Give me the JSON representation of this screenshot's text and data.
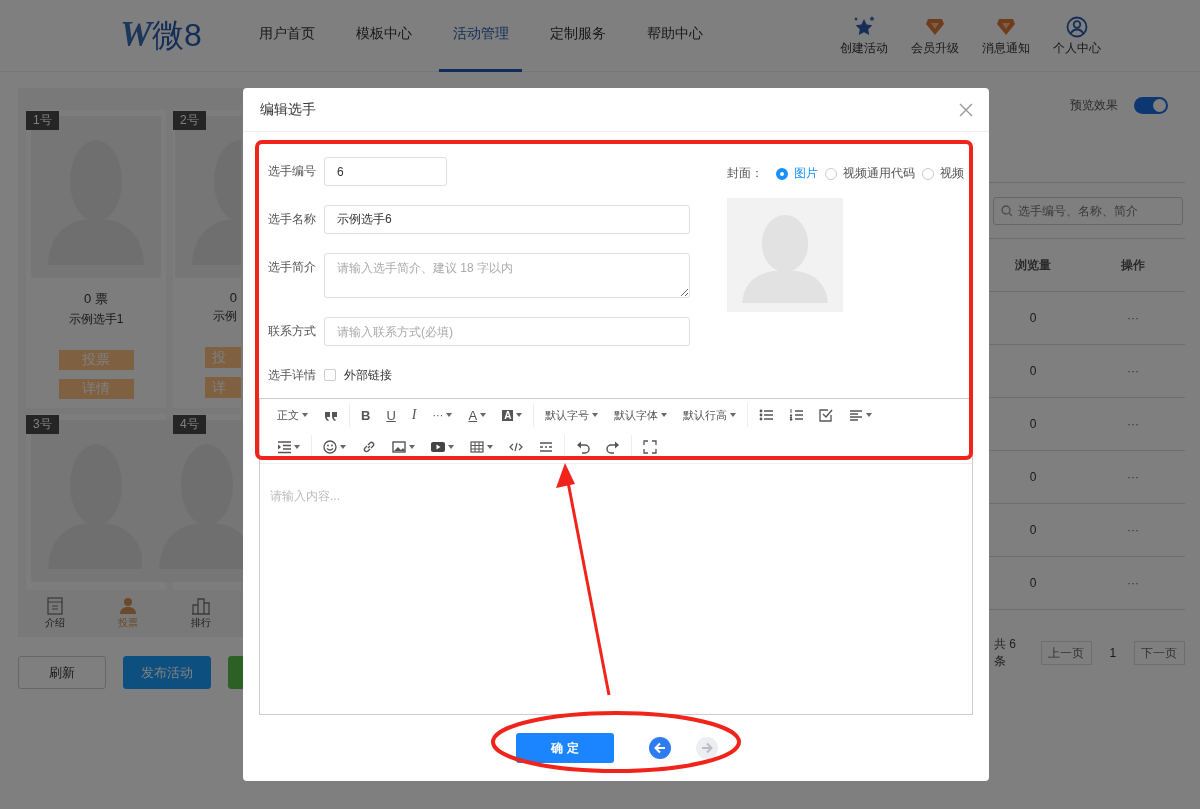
{
  "header": {
    "logo_mark": "W",
    "logo_text": "微8",
    "nav": [
      {
        "label": "用户首页",
        "selected": false
      },
      {
        "label": "模板中心",
        "selected": false
      },
      {
        "label": "活动管理",
        "selected": true
      },
      {
        "label": "定制服务",
        "selected": false
      },
      {
        "label": "帮助中心",
        "selected": false
      }
    ],
    "actions": [
      {
        "kind": "star",
        "label": "创建活动"
      },
      {
        "kind": "badge",
        "label": "会员升级"
      },
      {
        "kind": "badge",
        "label": "消息通知"
      },
      {
        "kind": "user",
        "label": "个人中心"
      }
    ]
  },
  "preview": {
    "cards": [
      {
        "kind": "full",
        "number": "1号",
        "votes": "0 票",
        "name": "示例选手1",
        "buttons": [
          "投票",
          "详情"
        ]
      },
      {
        "kind": "cut",
        "number": "2号",
        "votes": "0",
        "name": "示例",
        "buttons": [
          "投",
          "详"
        ]
      },
      {
        "kind": "short",
        "number": "3号"
      },
      {
        "kind": "short",
        "number": "4号"
      }
    ],
    "tabbar": [
      {
        "kind": "intro",
        "label": "介绍",
        "selected": false
      },
      {
        "kind": "vote",
        "label": "投票",
        "selected": true
      },
      {
        "kind": "rank",
        "label": "排行",
        "selected": false
      }
    ]
  },
  "buttons": [
    {
      "kind": "default",
      "label": "刷新"
    },
    {
      "kind": "primary",
      "label": "发布活动"
    },
    {
      "kind": "success"
    }
  ],
  "preview_toggle": {
    "label": "预览效果",
    "on": true
  },
  "search": {
    "placeholder": "选手编号、名称、简介"
  },
  "table": {
    "columns": [
      "浏览量",
      "操作"
    ],
    "rows": [
      {
        "views": "0",
        "action": "···"
      },
      {
        "views": "0",
        "action": "···"
      },
      {
        "views": "0",
        "action": "···"
      },
      {
        "views": "0",
        "action": "···"
      },
      {
        "views": "0",
        "action": "···"
      },
      {
        "views": "0",
        "action": "···"
      }
    ]
  },
  "pagination": {
    "total": "共 6 条",
    "prev": "上一页",
    "page": "1",
    "next": "下一页"
  },
  "modal": {
    "title": "编辑选手",
    "fields": [
      {
        "kind": "short",
        "label": "选手编号",
        "value": "6"
      },
      {
        "kind": "input",
        "label": "选手名称",
        "value": "示例选手6"
      },
      {
        "kind": "textarea",
        "label": "选手简介",
        "placeholder": "请输入选手简介、建议 18 字以内"
      },
      {
        "kind": "input",
        "label": "联系方式",
        "placeholder": "请输入联系方式(必填)"
      },
      {
        "kind": "checkbox",
        "label": "选手详情",
        "option": "外部链接",
        "checked": false
      }
    ],
    "cover": {
      "label": "封面：",
      "options": [
        {
          "label": "图片",
          "selected": true
        },
        {
          "label": "视频通用代码",
          "selected": false
        },
        {
          "label": "视频",
          "selected": false
        }
      ]
    },
    "editor": {
      "toolbar": [
        [
          [
            {
              "kind": "text",
              "label": "正文",
              "caret": true
            },
            {
              "kind": "quote"
            }
          ],
          [
            {
              "kind": "bold",
              "label": "B"
            },
            {
              "kind": "underline",
              "label": "U"
            },
            {
              "kind": "italic",
              "label": "I"
            },
            {
              "kind": "text",
              "label": "···",
              "caret": true
            },
            {
              "kind": "color",
              "label": "A",
              "caret": true
            },
            {
              "kind": "fill",
              "label": "A",
              "caret": true
            }
          ],
          [
            {
              "kind": "text",
              "label": "默认字号",
              "caret": true
            },
            {
              "kind": "text",
              "label": "默认字体",
              "caret": true
            },
            {
              "kind": "text",
              "label": "默认行高",
              "caret": true
            }
          ],
          [
            {
              "kind": "bullets"
            },
            {
              "kind": "numbers"
            },
            {
              "kind": "todo"
            },
            {
              "kind": "align",
              "caret": true
            }
          ]
        ],
        [
          [
            {
              "kind": "indent",
              "caret": true
            }
          ],
          [
            {
              "kind": "emoji",
              "caret": true
            },
            {
              "kind": "link"
            },
            {
              "kind": "image",
              "caret": true
            },
            {
              "kind": "video",
              "caret": true
            },
            {
              "kind": "table",
              "caret": true
            },
            {
              "kind": "code"
            },
            {
              "kind": "divider"
            }
          ],
          [
            {
              "kind": "undo"
            },
            {
              "kind": "redo"
            }
          ],
          [
            {
              "kind": "fullscreen"
            }
          ]
        ]
      ],
      "placeholder": "请输入内容..."
    },
    "footer": {
      "confirm": "确 定",
      "nav": [
        {
          "kind": "prev",
          "disabled": false
        },
        {
          "kind": "next",
          "disabled": true
        }
      ]
    }
  },
  "annotations": [
    {
      "kind": "rect"
    },
    {
      "kind": "arrow"
    },
    {
      "kind": "ellipse"
    }
  ]
}
